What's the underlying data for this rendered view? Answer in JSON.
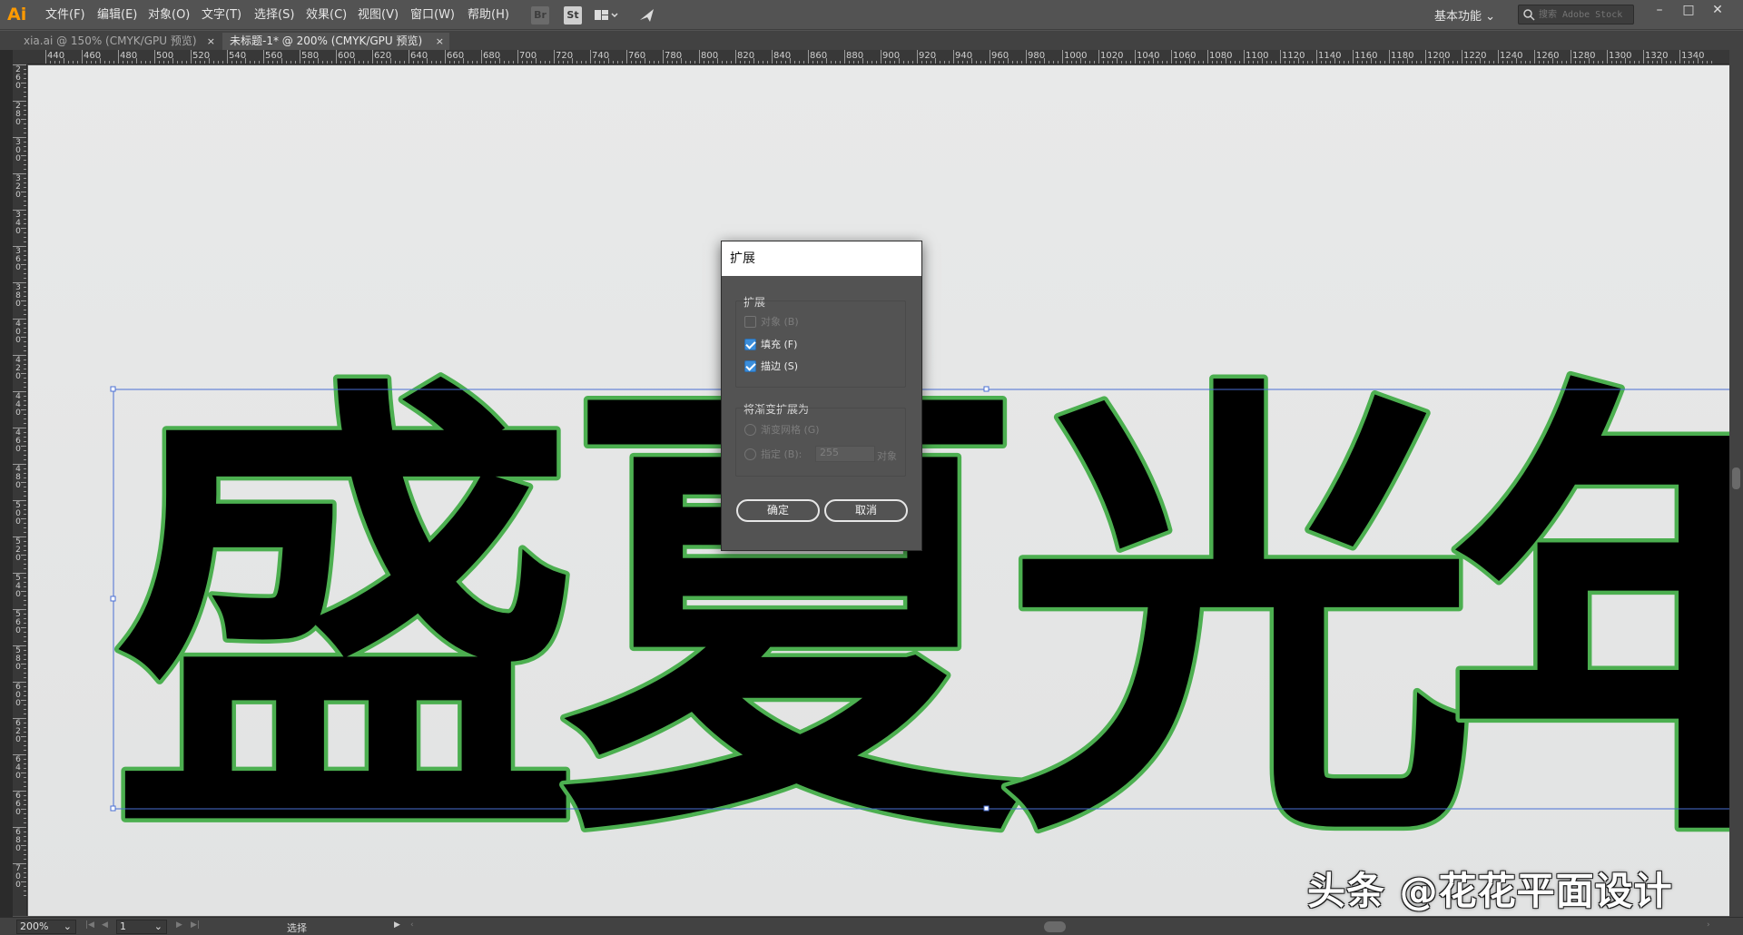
{
  "app": {
    "logo": "Ai",
    "menu": [
      "文件(F)",
      "编辑(E)",
      "对象(O)",
      "文字(T)",
      "选择(S)",
      "效果(C)",
      "视图(V)",
      "窗口(W)",
      "帮助(H)"
    ],
    "toolbar_icons": [
      "bridge-icon",
      "stock-icon",
      "arrange-documents-icon",
      "gpu-performance-icon"
    ],
    "toolbar_icon_labels": [
      "Br",
      "St"
    ],
    "workspace": "基本功能",
    "search_placeholder": "搜索 Adobe Stock",
    "window_controls": [
      "–",
      "□",
      "✕"
    ]
  },
  "tabs": [
    {
      "label": "xia.ai @ 150% (CMYK/GPU 预览)",
      "active": false,
      "close": "×"
    },
    {
      "label": "未标题-1* @ 200% (CMYK/GPU 预览)",
      "active": true,
      "close": "×"
    }
  ],
  "ruler": {
    "horizontal": [
      "440",
      "460",
      "480",
      "500",
      "520",
      "540",
      "560",
      "580",
      "600",
      "620",
      "640",
      "660",
      "680",
      "700",
      "720",
      "740",
      "760",
      "780",
      "800",
      "820",
      "840",
      "860",
      "880",
      "900",
      "920",
      "940",
      "960",
      "980",
      "1000",
      "1020",
      "1040",
      "1060",
      "1080",
      "1100",
      "1120",
      "1140",
      "1160",
      "1180",
      "1200",
      "1220",
      "1240",
      "1260",
      "1280",
      "1300",
      "1320",
      "1340"
    ],
    "vertical": [
      "260",
      "280",
      "300",
      "320",
      "340",
      "360",
      "380",
      "400",
      "420",
      "440",
      "460",
      "480",
      "500",
      "520",
      "540",
      "560",
      "580",
      "600",
      "620",
      "640",
      "660",
      "680",
      "700"
    ]
  },
  "artwork": {
    "characters": [
      "盛",
      "夏",
      "光",
      "年"
    ],
    "fill_color": "#000000",
    "stroke_color": "#4caf50",
    "selection_color": "#4a6fd4"
  },
  "dialog": {
    "title": "扩展",
    "expand_group_label": "扩展",
    "options": [
      {
        "label": "对象 (B)",
        "checked": false,
        "enabled": false
      },
      {
        "label": "填充 (F)",
        "checked": true,
        "enabled": true
      },
      {
        "label": "描边 (S)",
        "checked": true,
        "enabled": true
      }
    ],
    "gradient_group_label": "将渐变扩展为",
    "gradient_options": [
      {
        "label": "渐变网格 (G)",
        "enabled": false
      },
      {
        "label": "指定 (B):",
        "enabled": false
      }
    ],
    "specify_value": "255",
    "specify_unit": "对象",
    "ok_label": "确定",
    "cancel_label": "取消"
  },
  "status": {
    "zoom": "200%",
    "artboard": "1",
    "tool": "选择"
  },
  "watermark": "头条 @花花平面设计"
}
